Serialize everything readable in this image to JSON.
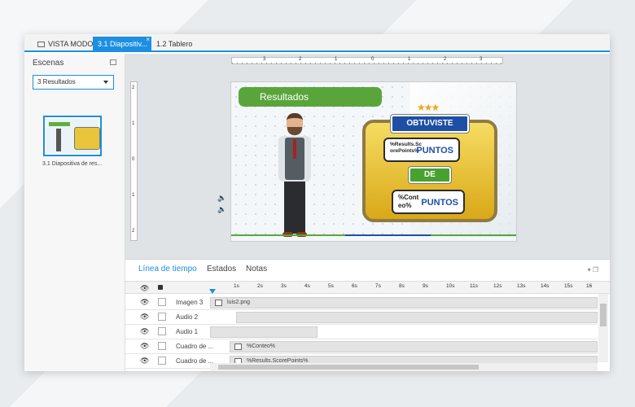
{
  "tabs": [
    {
      "label": "VISTA MODO HI...",
      "active": false
    },
    {
      "label": "3.1 Diapositiv...",
      "active": true
    },
    {
      "label": "1.2 Tablero",
      "active": false
    }
  ],
  "scenes": {
    "title": "Escenas",
    "selected": "3 Resultados",
    "thumb_label": "3.1 Diapositiva de res..."
  },
  "ruler": {
    "h_ticks": [
      "3",
      "2",
      "1",
      "0",
      "1",
      "2",
      "3"
    ],
    "v_ticks": [
      "2",
      "1",
      "0",
      "1",
      "2"
    ]
  },
  "slide": {
    "header": "Resultados",
    "obtuviste": "OBTUVISTE",
    "score_var": "%Results.Sc orePoints%",
    "puntos1": "PUNTOS",
    "de": "DE",
    "count_var": "%Cont eo%",
    "puntos2": "PUNTOS",
    "stars": "★★★"
  },
  "bottom_tabs": [
    {
      "label": "Línea de tiempo",
      "active": true
    },
    {
      "label": "Estados",
      "active": false
    },
    {
      "label": "Notas",
      "active": false
    }
  ],
  "timeline": {
    "ticks": [
      "1s",
      "2s",
      "3s",
      "4s",
      "5s",
      "6s",
      "7s",
      "8s",
      "9s",
      "10s",
      "11s",
      "12s",
      "13s",
      "14s",
      "15s",
      "16"
    ],
    "rows": [
      {
        "name": "Imagen 3",
        "track": "luis2.png"
      },
      {
        "name": "Audio 2",
        "track": ""
      },
      {
        "name": "Audio 1",
        "track": ""
      },
      {
        "name": "Cuadro de ...",
        "track": "%Conteo%"
      },
      {
        "name": "Cuadro de ...",
        "track": "%Results.ScorePoints%"
      }
    ]
  },
  "colors": {
    "accent": "#1d8fe1",
    "green": "#5aa53b",
    "blue_button": "#1e4fa5"
  }
}
